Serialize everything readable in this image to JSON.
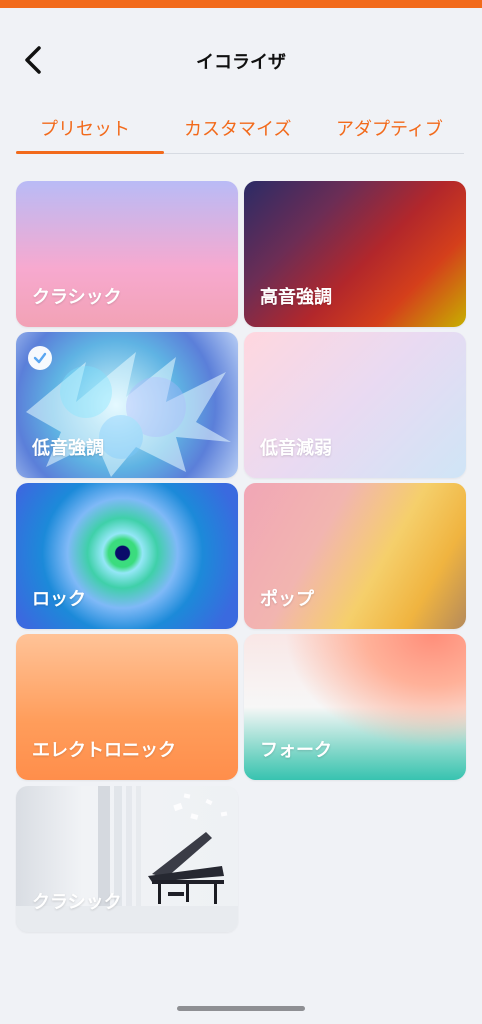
{
  "header": {
    "title": "イコライザ"
  },
  "tabs": [
    {
      "label": "プリセット",
      "selected": true
    },
    {
      "label": "カスタマイズ",
      "selected": false
    },
    {
      "label": "アダプティブ",
      "selected": false
    }
  ],
  "presets": [
    {
      "label": "クラシック",
      "selected": false
    },
    {
      "label": "高音強調",
      "selected": false
    },
    {
      "label": "低音強調",
      "selected": true
    },
    {
      "label": "低音減弱",
      "selected": false
    },
    {
      "label": "ロック",
      "selected": false
    },
    {
      "label": "ポップ",
      "selected": false
    },
    {
      "label": "エレクトロニック",
      "selected": false
    },
    {
      "label": "フォーク",
      "selected": false
    },
    {
      "label": "クラシック",
      "selected": false
    }
  ],
  "colors": {
    "accent": "#f26a1b",
    "background": "#f0f2f6"
  },
  "icons": {
    "back": "chevron-left-icon",
    "selected": "check-icon"
  }
}
